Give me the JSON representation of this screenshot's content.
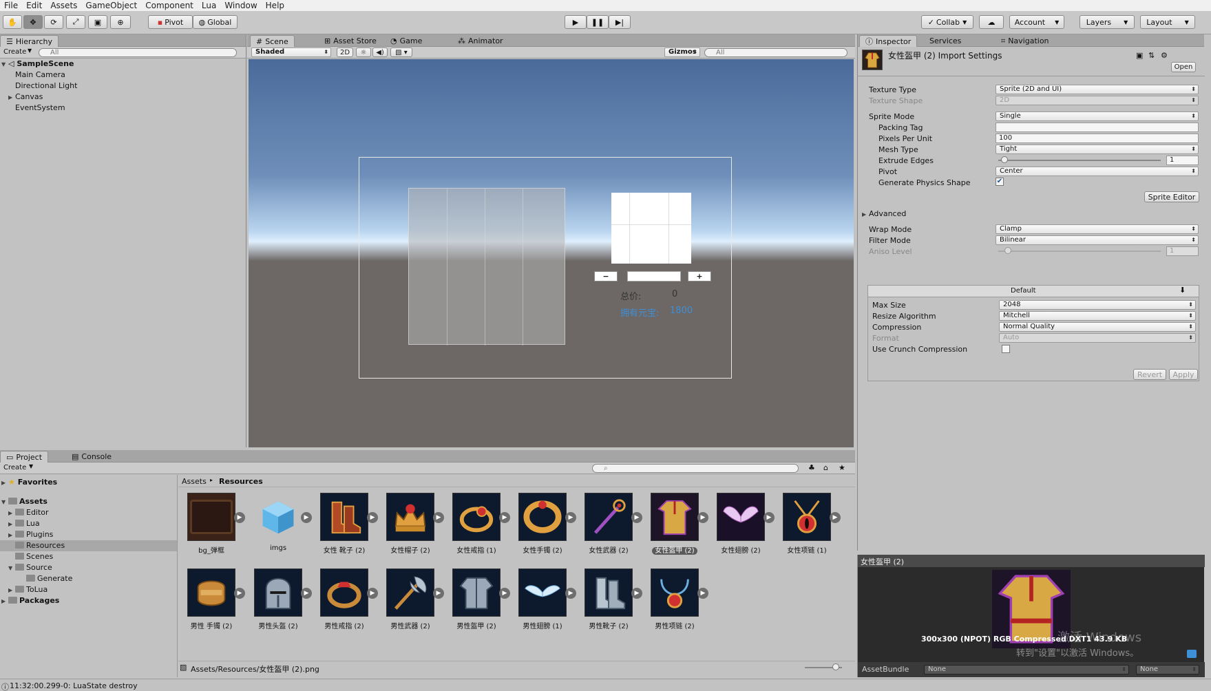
{
  "menu": [
    "File",
    "Edit",
    "Assets",
    "GameObject",
    "Component",
    "Lua",
    "Window",
    "Help"
  ],
  "toolbar": {
    "pivot": "Pivot",
    "global": "Global",
    "collab": "Collab",
    "account": "Account",
    "layers": "Layers",
    "layout": "Layout"
  },
  "hierarchy": {
    "tab": "Hierarchy",
    "create": "Create",
    "search_placeholder": "All",
    "scene": "SampleScene",
    "items": [
      "Main Camera",
      "Directional Light",
      "Canvas",
      "EventSystem"
    ]
  },
  "scene_view": {
    "tabs": [
      "Scene",
      "Asset Store",
      "Game",
      "Animator"
    ],
    "shading": "Shaded",
    "mode_2d": "2D",
    "gizmos": "Gizmos",
    "search_placeholder": "All",
    "minus": "−",
    "plus": "+",
    "total_label": "总价:",
    "total_value": "0",
    "owned_label": "拥有元宝:",
    "owned_value": "1800"
  },
  "inspector": {
    "tabs": [
      "Inspector",
      "Services",
      "Navigation"
    ],
    "title": "女性盔甲 (2) Import Settings",
    "open": "Open",
    "texture_type_label": "Texture Type",
    "texture_type": "Sprite (2D and UI)",
    "texture_shape_label": "Texture Shape",
    "texture_shape": "2D",
    "sprite_mode_label": "Sprite Mode",
    "sprite_mode": "Single",
    "packing_tag_label": "Packing Tag",
    "packing_tag": "",
    "ppu_label": "Pixels Per Unit",
    "ppu": "100",
    "mesh_type_label": "Mesh Type",
    "mesh_type": "Tight",
    "extrude_label": "Extrude Edges",
    "extrude": "1",
    "pivot_label": "Pivot",
    "pivot": "Center",
    "physics_label": "Generate Physics Shape",
    "physics_checked": true,
    "sprite_editor": "Sprite Editor",
    "advanced": "Advanced",
    "wrap_label": "Wrap Mode",
    "wrap": "Clamp",
    "filter_label": "Filter Mode",
    "filter": "Bilinear",
    "aniso_label": "Aniso Level",
    "aniso": "1",
    "platform": "Default",
    "max_size_label": "Max Size",
    "max_size": "2048",
    "resize_label": "Resize Algorithm",
    "resize": "Mitchell",
    "compression_label": "Compression",
    "compression": "Normal Quality",
    "format_label": "Format",
    "format": "Auto",
    "crunch_label": "Use Crunch Compression",
    "revert": "Revert",
    "apply": "Apply"
  },
  "preview": {
    "title": "女性盔甲 (2)",
    "info": "300x300 (NPOT)  RGB Compressed DXT1  43.9 KB",
    "watermark1": "激活 Windows",
    "watermark2": "转到\"设置\"以激活 Windows。",
    "assetbundle_label": "AssetBundle",
    "bundle1": "None",
    "bundle2": "None"
  },
  "project": {
    "tabs": [
      "Project",
      "Console"
    ],
    "create": "Create",
    "favorites": "Favorites",
    "assets": "Assets",
    "folders": [
      "Editor",
      "Lua",
      "Plugins",
      "Resources",
      "Scenes",
      "Source",
      "Generate",
      "ToLua"
    ],
    "packages": "Packages",
    "breadcrumb_root": "Assets",
    "breadcrumb_current": "Resources",
    "items": [
      {
        "name": "bg_弹框",
        "icon": "panel-icon"
      },
      {
        "name": "imgs",
        "icon": "cube-icon"
      },
      {
        "name": "女性 靴子 (2)",
        "icon": "boots-icon"
      },
      {
        "name": "女性帽子 (2)",
        "icon": "crown-icon"
      },
      {
        "name": "女性戒指 (1)",
        "icon": "ring-icon"
      },
      {
        "name": "女性手镯 (2)",
        "icon": "bracelet-icon"
      },
      {
        "name": "女性武器 (2)",
        "icon": "staff-icon"
      },
      {
        "name": "女性盔甲 (2)",
        "icon": "robe-icon"
      },
      {
        "name": "女性翅膀 (2)",
        "icon": "wings-icon"
      },
      {
        "name": "女性项链 (1)",
        "icon": "necklace-icon"
      },
      {
        "name": "男性 手镯 (2)",
        "icon": "bracelet-icon"
      },
      {
        "name": "男性头盔 (2)",
        "icon": "helmet-icon"
      },
      {
        "name": "男性戒指 (2)",
        "icon": "ring-icon"
      },
      {
        "name": "男性武器 (2)",
        "icon": "axe-icon"
      },
      {
        "name": "男性盔甲 (2)",
        "icon": "armor-icon"
      },
      {
        "name": "男性翅膀 (1)",
        "icon": "wings-icon"
      },
      {
        "name": "男性靴子 (2)",
        "icon": "boots-icon"
      },
      {
        "name": "男性项链 (2)",
        "icon": "necklace-icon"
      }
    ],
    "path": "Assets/Resources/女性盔甲 (2).png"
  },
  "status": "11:32:00.299-0: LuaState destroy",
  "colors": {
    "accent": "#3d8fd6",
    "selection": "#5a5a5a",
    "sky_top": "#4a6a9a",
    "ground": "#6d6866"
  }
}
